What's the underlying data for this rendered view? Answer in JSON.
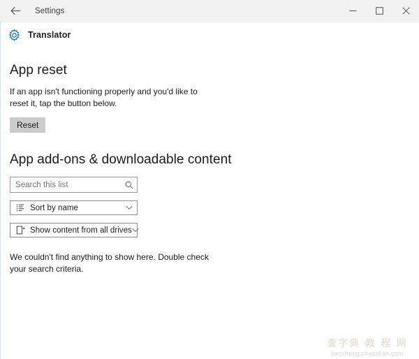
{
  "titlebar": {
    "back_icon": "back-arrow-icon",
    "title": "Settings",
    "minimize_icon": "minimize-icon",
    "maximize_icon": "maximize-icon",
    "close_icon": "close-icon"
  },
  "app_header": {
    "icon": "gear-icon",
    "name": "Translator"
  },
  "app_reset": {
    "heading": "App reset",
    "description": "If an app isn't functioning properly and you'd like to reset it, tap the button below.",
    "reset_button": "Reset"
  },
  "addons": {
    "heading": "App add-ons & downloadable content",
    "search": {
      "placeholder": "Search this list",
      "value": "",
      "icon": "search-icon"
    },
    "sort_dropdown": {
      "icon": "sort-list-icon",
      "label": "Sort by name",
      "chevron": "chevron-down-icon"
    },
    "drives_dropdown": {
      "icon": "drive-content-icon",
      "label": "Show content from all drives",
      "chevron": "chevron-down-icon"
    },
    "empty_message": "We couldn't find anything to show here. Double check your search criteria."
  },
  "watermark": {
    "chinese": "查字典 教 程 网",
    "url": "jiaocheng.chazidian.com"
  },
  "colors": {
    "accent": "#1675c0",
    "titlebar_bg": "#f2f2f2",
    "button_bg": "#cccccc",
    "content_bg": "#ffffff",
    "text": "#1a1a1a",
    "placeholder": "#767676"
  }
}
